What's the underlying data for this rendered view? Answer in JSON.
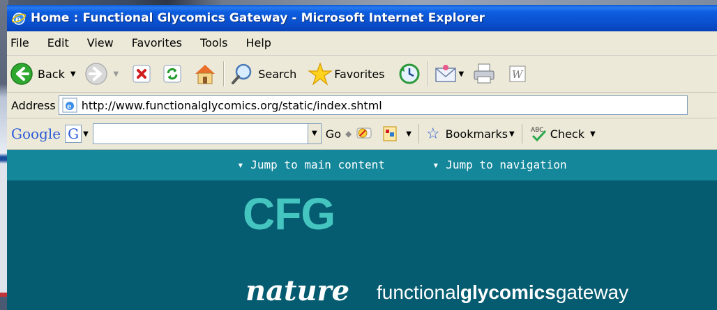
{
  "window": {
    "title": "Home : Functional Glycomics Gateway - Microsoft Internet Explorer"
  },
  "menu": [
    "File",
    "Edit",
    "View",
    "Favorites",
    "Tools",
    "Help"
  ],
  "toolbar": {
    "back_label": "Back",
    "search_label": "Search",
    "favorites_label": "Favorites"
  },
  "address": {
    "label": "Address",
    "url": "http://www.functionalglycomics.org/static/index.shtml"
  },
  "google_toolbar": {
    "logo": "Google",
    "g_button": "G",
    "go_label": "Go",
    "bookmarks_label": "Bookmarks",
    "check_label": "Check"
  },
  "page": {
    "skip_main": "▾ Jump to main content",
    "skip_nav": "▾ Jump to navigation",
    "logo_text": "CFG",
    "nature_text": "nature",
    "gateway_prefix": "functional",
    "gateway_bold": "glycomics",
    "gateway_suffix": "gateway"
  },
  "colors": {
    "titlebar": "#0a4ecb",
    "chrome": "#ece9d8",
    "page_header": "#055c70",
    "skip_bar": "#14879b",
    "cfg_logo": "#45c5c0"
  }
}
